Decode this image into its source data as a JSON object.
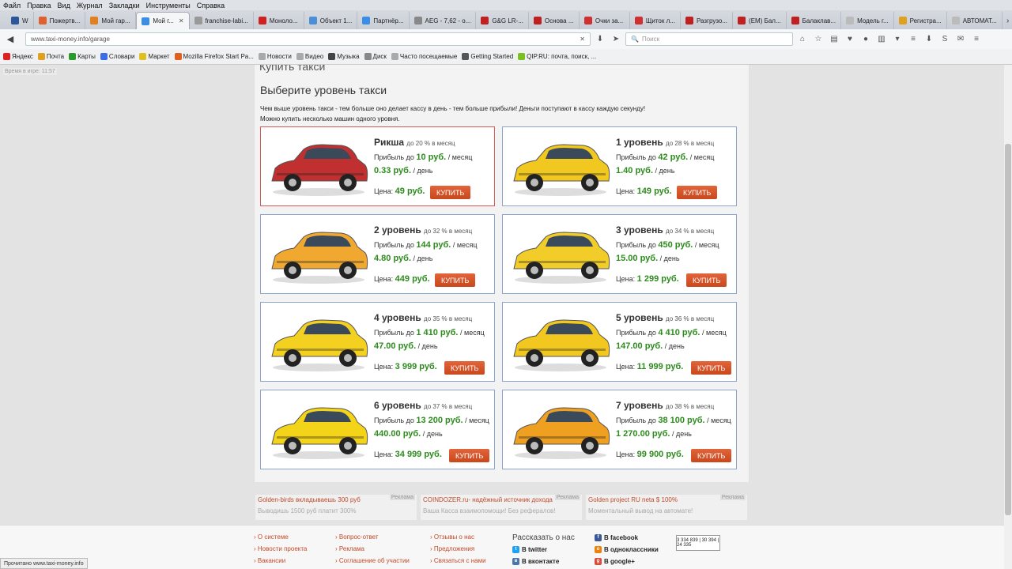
{
  "menubar": [
    "Файл",
    "Правка",
    "Вид",
    "Журнал",
    "Закладки",
    "Инструменты",
    "Справка"
  ],
  "tabs": [
    {
      "label": "W",
      "color": "#2b579a"
    },
    {
      "label": "Пожертв...",
      "color": "#e06030"
    },
    {
      "label": "Мой гар...",
      "color": "#e08020"
    },
    {
      "label": "Мой г...",
      "color": "#3a8ee6",
      "active": true
    },
    {
      "label": "franchise-labi...",
      "color": "#999"
    },
    {
      "label": "Моноло...",
      "color": "#d02020"
    },
    {
      "label": "Объект 1...",
      "color": "#4a90d9"
    },
    {
      "label": "Партнёр...",
      "color": "#3a8ee6"
    },
    {
      "label": "AEG - 7,62 - о...",
      "color": "#888"
    },
    {
      "label": "G&G LR-...",
      "color": "#c02020"
    },
    {
      "label": "Основа ...",
      "color": "#c02020"
    },
    {
      "label": "Очки за...",
      "color": "#d03030"
    },
    {
      "label": "Щиток л...",
      "color": "#d03030"
    },
    {
      "label": "Разгрузо...",
      "color": "#c02020"
    },
    {
      "label": "(ЕМ) Бал...",
      "color": "#c02020"
    },
    {
      "label": "Балаклав...",
      "color": "#c02020"
    },
    {
      "label": "Модель г...",
      "color": "#bbb"
    },
    {
      "label": "Регистра...",
      "color": "#e0a020"
    },
    {
      "label": "АВТОМАТ...",
      "color": "#bbb"
    }
  ],
  "nav": {
    "url": "www.taxi-money.info/garage",
    "search_placeholder": "Поиск"
  },
  "bookmarks": [
    {
      "label": "Яндекс",
      "color": "#e02020"
    },
    {
      "label": "Почта",
      "color": "#e0a020"
    },
    {
      "label": "Карты",
      "color": "#2a9a2a"
    },
    {
      "label": "Словари",
      "color": "#3a6ee6"
    },
    {
      "label": "Маркет",
      "color": "#e0c020"
    },
    {
      "label": "Mozilla Firefox Start Pa...",
      "color": "#e06020"
    },
    {
      "label": "Новости",
      "color": "#aaa"
    },
    {
      "label": "Видео",
      "color": "#aaa"
    },
    {
      "label": "Музыка",
      "color": "#444"
    },
    {
      "label": "Диск",
      "color": "#888"
    },
    {
      "label": "Часто посещаемые",
      "color": "#aaa"
    },
    {
      "label": "Getting Started",
      "color": "#555"
    },
    {
      "label": "QIP.RU: почта, поиск, ...",
      "color": "#7ac020"
    }
  ],
  "page": {
    "game_time": "Время в игре: 11:57",
    "section_title": "Купить такси",
    "heading": "Выберите уровень такси",
    "desc1": "Чем выше уровень такси - тем больше оно делает кассу в день - тем больше прибыли! Деньги поступают в кассу каждую секунду!",
    "desc2": "Можно купить несколько машин одного уровня."
  },
  "labels": {
    "profit": "Прибыль до",
    "per_month": "/ месяц",
    "per_day": "/ день",
    "price": "Цена:",
    "buy": "КУПИТЬ"
  },
  "cards": [
    {
      "name": "Рикша",
      "pct": "до 20 % в месяц",
      "profit_month": "10 руб.",
      "profit_day": "0.33 руб.",
      "price": "49 руб.",
      "color": "#c03030"
    },
    {
      "name": "1 уровень",
      "pct": "до 28 % в месяц",
      "profit_month": "42 руб.",
      "profit_day": "1.40 руб.",
      "price": "149 руб.",
      "color": "#f0c820"
    },
    {
      "name": "2 уровень",
      "pct": "до 32 % в месяц",
      "profit_month": "144 руб.",
      "profit_day": "4.80 руб.",
      "price": "449 руб.",
      "color": "#f0a830"
    },
    {
      "name": "3 уровень",
      "pct": "до 34 % в месяц",
      "profit_month": "450 руб.",
      "profit_day": "15.00 руб.",
      "price": "1 299 руб.",
      "color": "#f2cc28"
    },
    {
      "name": "4 уровень",
      "pct": "до 35 % в месяц",
      "profit_month": "1 410 руб.",
      "profit_day": "47.00 руб.",
      "price": "3 999 руб.",
      "color": "#f4d020"
    },
    {
      "name": "5 уровень",
      "pct": "до 36 % в месяц",
      "profit_month": "4 410 руб.",
      "profit_day": "147.00 руб.",
      "price": "11 999 руб.",
      "color": "#f2c820"
    },
    {
      "name": "6 уровень",
      "pct": "до 37 % в месяц",
      "profit_month": "13 200 руб.",
      "profit_day": "440.00 руб.",
      "price": "34 999 руб.",
      "color": "#f4d418"
    },
    {
      "name": "7 уровень",
      "pct": "до 38 % в месяц",
      "profit_month": "38 100 руб.",
      "profit_day": "1 270.00 руб.",
      "price": "99 900 руб.",
      "color": "#f0a020"
    }
  ],
  "ads": [
    {
      "title": "Golden-birds вкладываешь 300 руб",
      "text": "Выводишь 1500 руб платит 300%",
      "tag": "Реклама"
    },
    {
      "title": "COINDOZER.ru- надёжный источник дохода",
      "text": "Ваша Касса взаимопомощи! Без рефералов!",
      "tag": "Реклама"
    },
    {
      "title": "Golden project RU neta $ 100%",
      "text": "Моментальный вывод на автомате!",
      "tag": "Реклама"
    }
  ],
  "footer": {
    "col1": [
      "О системе",
      "Новости проекта",
      "Вакансии"
    ],
    "col2": [
      "Вопрос-ответ",
      "Реклама",
      "Соглашение об участии"
    ],
    "col3": [
      "Отзывы о нас",
      "Предложения",
      "Связаться с нами"
    ],
    "share_title": "Рассказать о нас",
    "social": [
      {
        "label": "В facebook",
        "color": "#3b5998",
        "g": "f"
      },
      {
        "label": "В twitter",
        "color": "#1da1f2",
        "g": "t"
      },
      {
        "label": "В вконтакте",
        "color": "#4a76a8",
        "g": "в"
      },
      {
        "label": "В одноклассники",
        "color": "#ee8208",
        "g": "о"
      },
      {
        "label": "В google+",
        "color": "#dd4b39",
        "g": "g"
      }
    ],
    "counter": "3 334 839 | 30 394 | 24 335"
  },
  "status": "Прочитано www.taxi-money.info"
}
